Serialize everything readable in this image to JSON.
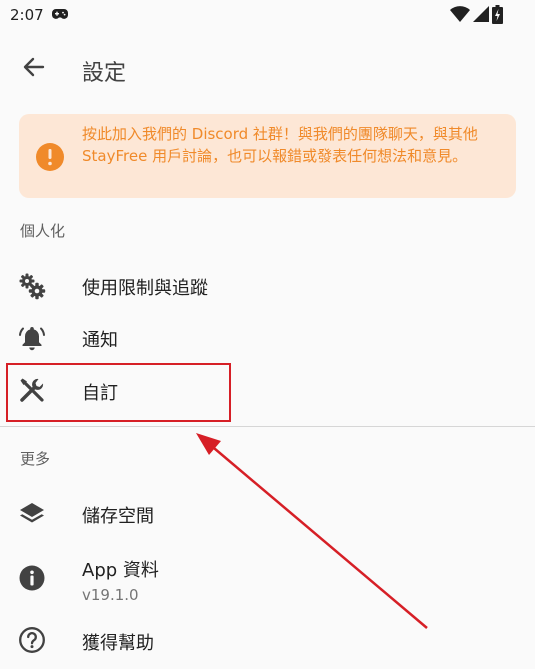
{
  "status_bar": {
    "time": "2:07"
  },
  "app_bar": {
    "title": "設定"
  },
  "banner": {
    "text": "按此加入我們的 Discord 社群！與我們的團隊聊天，與其他 StayFree 用戶討論，也可以報錯或發表任何想法和意見。"
  },
  "sections": {
    "personalization": "個人化",
    "more": "更多"
  },
  "items": {
    "usage_limits": "使用限制與追蹤",
    "notifications": "通知",
    "customize": "自訂",
    "storage": "儲存空間",
    "app_info": "App 資料",
    "app_version": "v19.1.0",
    "help": "獲得幫助"
  },
  "colors": {
    "accent": "#f08a2a",
    "banner_bg": "#fde7d6",
    "annotation": "#d61f26"
  }
}
